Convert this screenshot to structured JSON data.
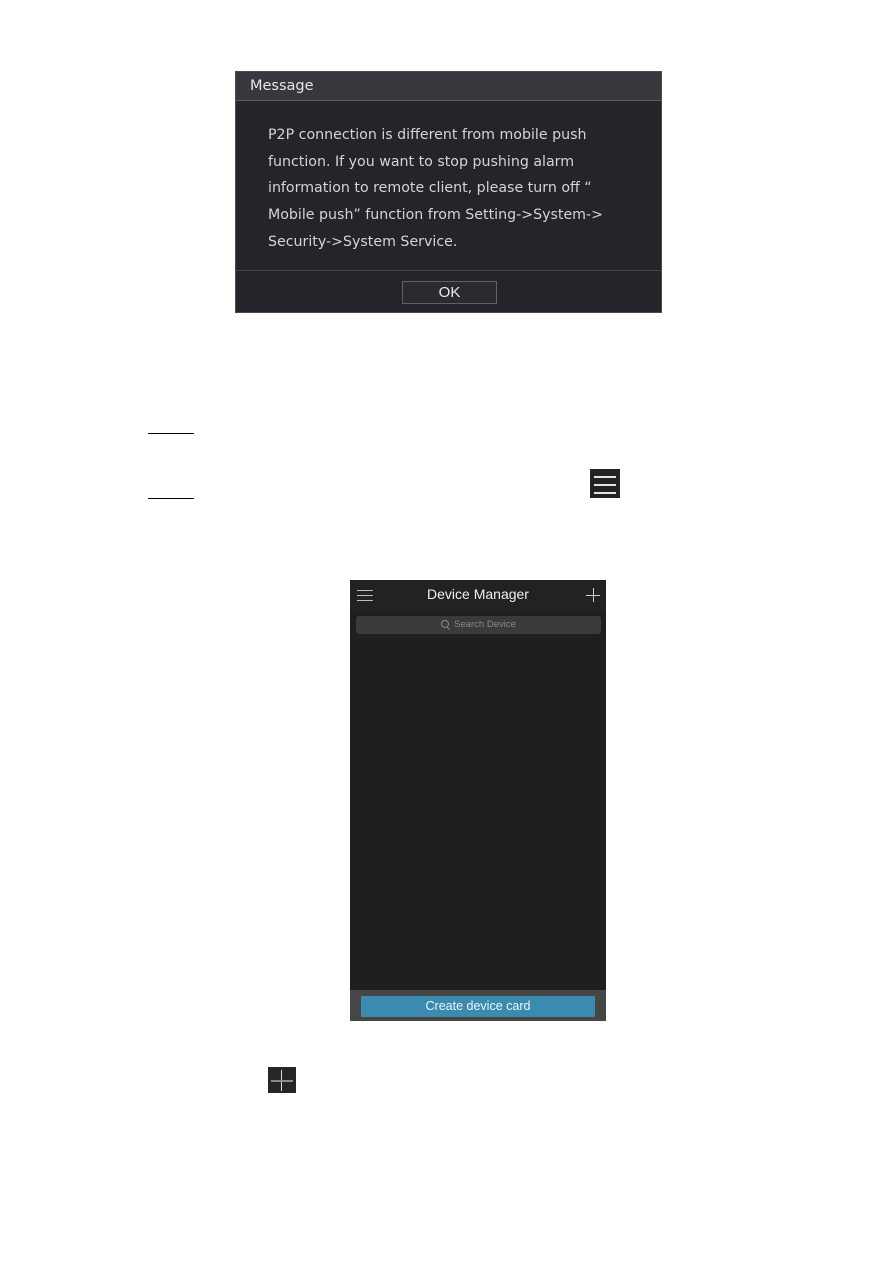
{
  "message_dialog": {
    "title": "Message",
    "body_lines": [
      "P2P connection is different from mobile push",
      "function. If you want to stop pushing alarm",
      "information to remote client, please turn off “",
      "Mobile push” function from Setting->System->",
      "Security->System Service."
    ],
    "ok_label": "OK"
  },
  "inline_icons": {
    "menu": "menu-icon",
    "add": "plus-icon"
  },
  "device_manager": {
    "title": "Device Manager",
    "menu_icon": "menu-icon",
    "add_icon": "plus-icon",
    "search_placeholder": "Search Device",
    "devices": [],
    "create_card_label": "Create device card",
    "colors": {
      "button": "#3b8bb0",
      "background": "#1f1f1f"
    }
  }
}
